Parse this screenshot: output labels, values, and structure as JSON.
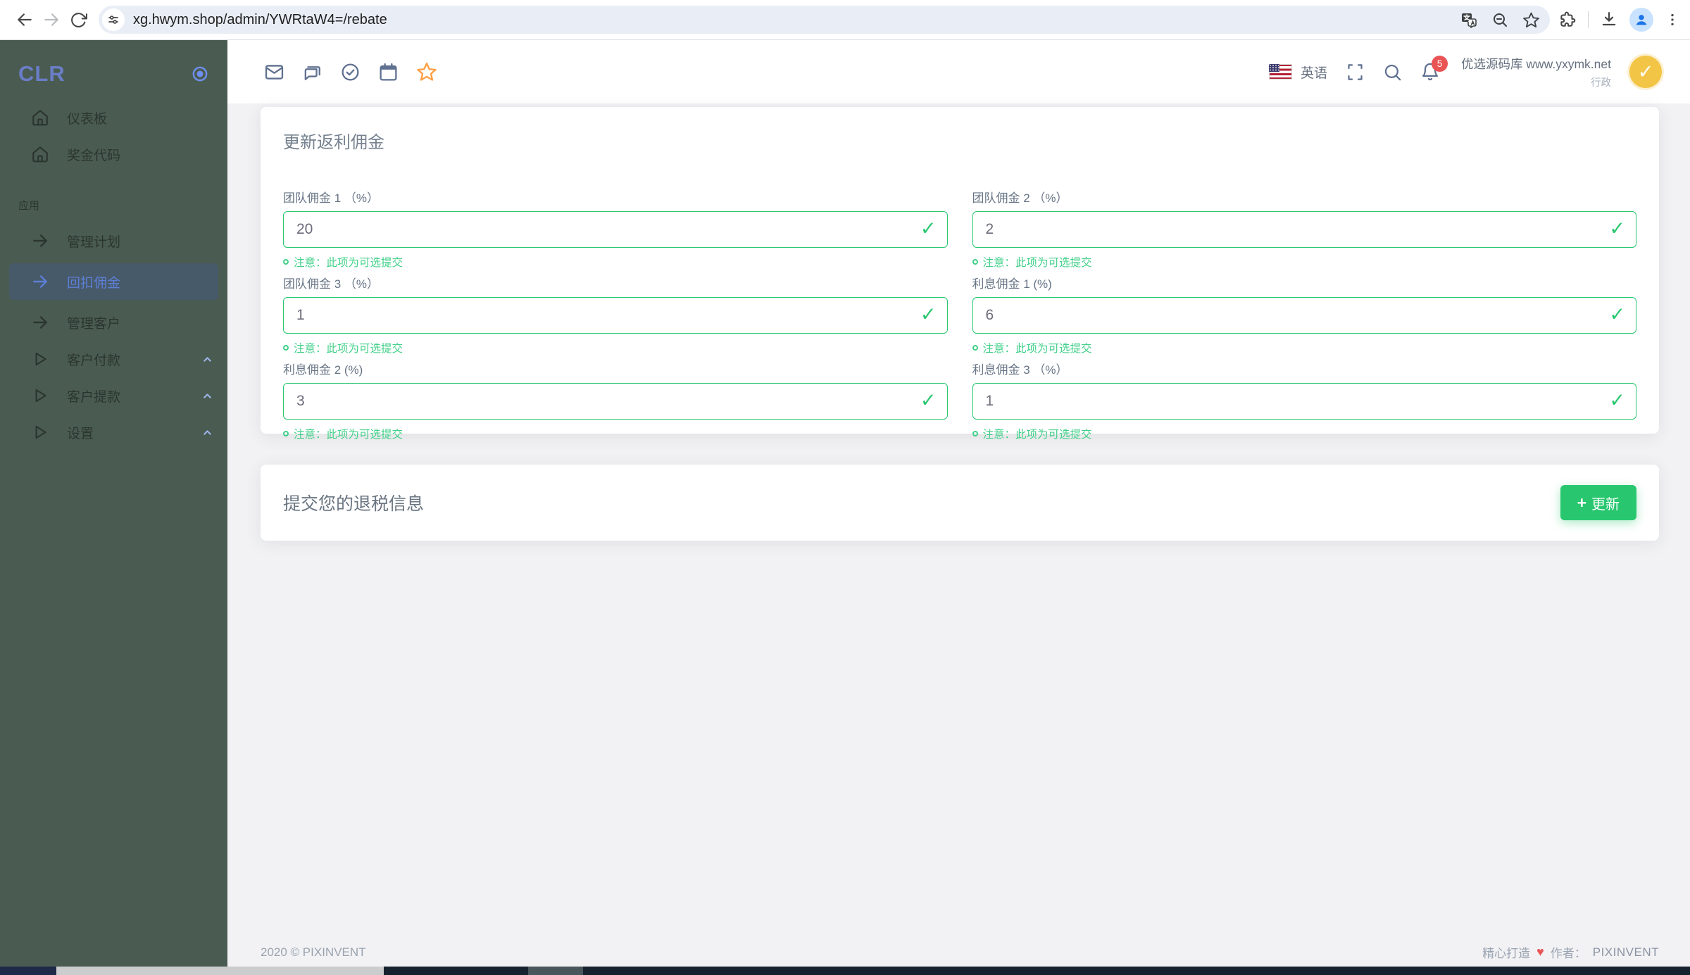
{
  "browser": {
    "url": "xg.hwym.shop/admin/YWRtaW4=/rebate"
  },
  "sidebar": {
    "logo": "CLR",
    "section_label": "应用",
    "items": [
      {
        "label": "仪表板",
        "icon": "home-icon"
      },
      {
        "label": "奖金代码",
        "icon": "home-icon"
      },
      {
        "label": "管理计划",
        "icon": "arrow-right-icon"
      },
      {
        "label": "回扣佣金",
        "icon": "arrow-right-icon",
        "active": true
      },
      {
        "label": "管理客户",
        "icon": "arrow-right-icon"
      },
      {
        "label": "客户付款",
        "icon": "play-icon",
        "chevron": "up"
      },
      {
        "label": "客户提款",
        "icon": "play-icon",
        "chevron": "up"
      },
      {
        "label": "设置",
        "icon": "play-icon",
        "chevron": "up"
      }
    ]
  },
  "navbar": {
    "language": "英语",
    "notification_count": "5",
    "user_name": "优选源码库 www.yxymk.net",
    "user_role": "行政"
  },
  "rebate_card": {
    "title": "更新返利佣金",
    "note": "注意：此项为可选提交",
    "fields": [
      {
        "label": "团队佣金 1 （%）",
        "value": "20"
      },
      {
        "label": "团队佣金 2 （%）",
        "value": "2"
      },
      {
        "label": "团队佣金 3 （%）",
        "value": "1"
      },
      {
        "label": "利息佣金 1 (%)",
        "value": "6"
      },
      {
        "label": "利息佣金 2 (%)",
        "value": "3"
      },
      {
        "label": "利息佣金 3 （%）",
        "value": "1"
      }
    ]
  },
  "submit_card": {
    "title": "提交您的退税信息",
    "button_label": "更新",
    "button_icon": "+"
  },
  "footer": {
    "left": "2020 © PIXINVENT",
    "made_with": "精心打造",
    "heart": "♥",
    "author_prefix": "作者：",
    "author": "PIXINVENT"
  },
  "icons": {
    "check": "✓"
  },
  "colors": {
    "success": "#28c76f",
    "sidebar_bg": "#4a5c51",
    "active_link": "#5d7fd6",
    "badge_red": "#ea5455",
    "star_orange": "#ff9f43",
    "avatar_yellow": "#f2c546"
  }
}
